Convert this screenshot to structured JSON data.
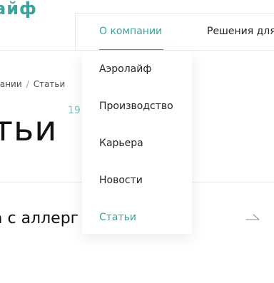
{
  "header": {
    "logo_text": "айф",
    "nav": [
      {
        "label": "О компании"
      },
      {
        "label": "Решения для"
      }
    ]
  },
  "breadcrumb": {
    "items": [
      "пании",
      "Статьи"
    ]
  },
  "page": {
    "title": "тьи",
    "count": "19"
  },
  "article": {
    "title": "а с аллерг"
  },
  "dropdown": {
    "items": [
      {
        "label": "Аэролайф"
      },
      {
        "label": "Производство"
      },
      {
        "label": "Карьера"
      },
      {
        "label": "Новости"
      },
      {
        "label": "Статьи"
      }
    ]
  },
  "colors": {
    "accent": "#3aa39b",
    "text": "#1f2326",
    "divider": "#e6e8ea"
  }
}
